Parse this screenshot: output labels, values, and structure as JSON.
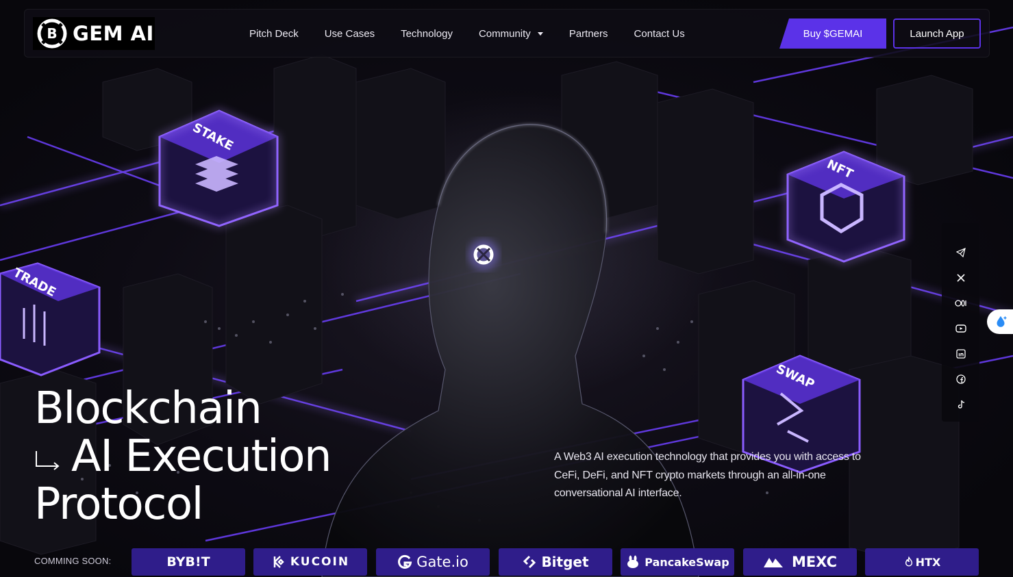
{
  "brand": {
    "name": "GEM AI"
  },
  "nav": {
    "items": [
      {
        "label": "Pitch Deck"
      },
      {
        "label": "Use Cases"
      },
      {
        "label": "Technology"
      },
      {
        "label": "Community"
      },
      {
        "label": "Partners"
      },
      {
        "label": "Contact Us"
      }
    ]
  },
  "actions": {
    "buy_label": "Buy $GEMAI",
    "launch_label": "Launch App"
  },
  "hero": {
    "title_line1": "Blockchain",
    "title_line2": "AI Execution",
    "title_line3": "Protocol",
    "description": "A Web3 AI execution technology that provides you with access to CeFi, DeFi, and NFT crypto markets through an all-in-one conversational AI interface."
  },
  "cubes": {
    "stake": "STAKE",
    "trade": "TRADE",
    "nft": "NFT",
    "swap": "SWAP"
  },
  "social": {
    "icons": [
      "telegram-icon",
      "x-icon",
      "medium-icon",
      "youtube-icon",
      "linkedin-icon",
      "facebook-icon",
      "tiktok-icon"
    ]
  },
  "exchanges": {
    "label": "COMMING SOON:",
    "items": [
      {
        "name": "BYB!T"
      },
      {
        "name": "KUCOIN"
      },
      {
        "name": "Gate.io"
      },
      {
        "name": "Bitget"
      },
      {
        "name": "PancakeSwap"
      },
      {
        "name": "MEXC"
      },
      {
        "name": "HTX"
      }
    ]
  },
  "colors": {
    "accent": "#5b32e8",
    "exchange_bg": "#2f1d8a",
    "glow": "#7b4dff"
  }
}
